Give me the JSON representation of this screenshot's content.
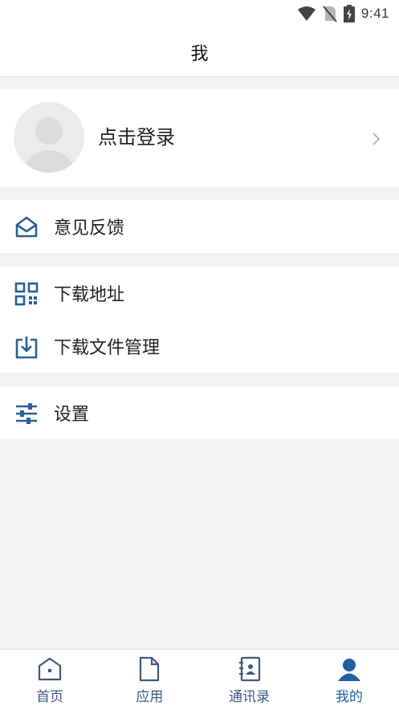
{
  "status_bar": {
    "time": "9:41",
    "icons": [
      "wifi-icon",
      "no-sim-icon",
      "battery-charging-icon"
    ]
  },
  "header": {
    "title": "我"
  },
  "profile": {
    "login_label": "点击登录"
  },
  "menu": {
    "feedback": {
      "label": "意见反馈",
      "icon": "mail-open-icon"
    },
    "download_address": {
      "label": "下载地址",
      "icon": "qr-code-icon"
    },
    "download_files": {
      "label": "下载文件管理",
      "icon": "download-tray-icon"
    },
    "settings": {
      "label": "设置",
      "icon": "sliders-icon"
    }
  },
  "tabbar": {
    "tabs": [
      {
        "label": "首页",
        "icon": "home-icon"
      },
      {
        "label": "应用",
        "icon": "document-icon"
      },
      {
        "label": "通讯录",
        "icon": "contacts-book-icon"
      },
      {
        "label": "我的",
        "icon": "user-icon",
        "active": true
      }
    ]
  },
  "colors": {
    "accent": "#1f5fa3",
    "icon": "#2c5f95",
    "background": "#f2f2f2"
  }
}
